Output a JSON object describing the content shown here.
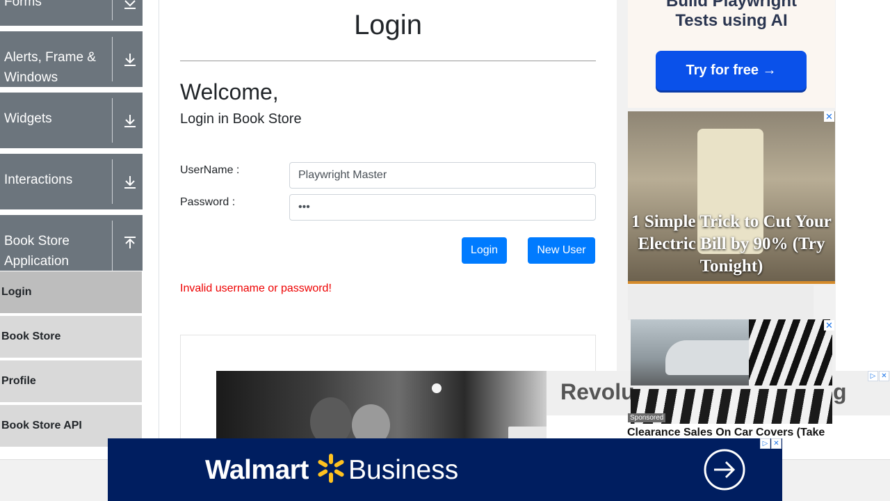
{
  "sidebar": {
    "groups": [
      {
        "label": "Forms",
        "icon": "chevron-down-icon"
      },
      {
        "label_line1": "Alerts, Frame &",
        "label_line2": "Windows",
        "icon": "download-arrow-icon"
      },
      {
        "label": "Widgets",
        "icon": "download-arrow-icon"
      },
      {
        "label": "Interactions",
        "icon": "download-arrow-icon"
      },
      {
        "label_line1": "Book Store",
        "label_line2": "Application",
        "icon": "upload-arrow-icon"
      }
    ],
    "items": [
      "Login",
      "Book Store",
      "Profile",
      "Book Store API"
    ],
    "active_item": "Login"
  },
  "main": {
    "title": "Login",
    "welcome": "Welcome,",
    "subtitle": "Login in Book Store",
    "username_label": "UserName :",
    "username_value": "Playwright Master",
    "password_label": "Password :",
    "password_value": "•••",
    "login_button": "Login",
    "new_user_button": "New User",
    "error": "Invalid username or password!"
  },
  "ads": {
    "top_tagline": "Build Playwright\nTests using AI",
    "top_cta": "Try for free →",
    "outlet_headline": "1 Simple Trick to Cut Your Electric Bill by 90% (Try Tonight)",
    "revol_text": "Revolu",
    "revol_tail": "g",
    "sponsored": "Sponsored",
    "car_headline": "Clearance Sales On Car Covers (Take",
    "walmart_brand": "Walmart",
    "walmart_brand2": "Business",
    "close_glyph": "✕"
  },
  "colors": {
    "sidebar_group_bg": "#6c757d",
    "sub_item_bg": "#d9d9d9",
    "sub_item_active_bg": "#bdbdbd",
    "primary_button": "#007bff",
    "error_text": "#ee0000",
    "walmart_navy": "#001e60",
    "walmart_yellow": "#ffc220"
  }
}
